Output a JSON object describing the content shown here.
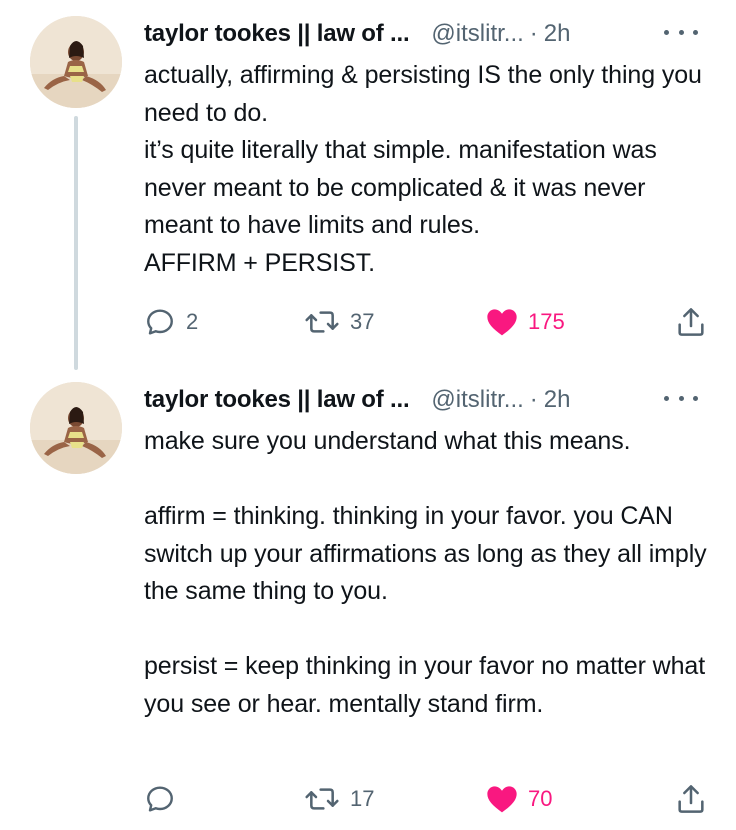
{
  "tweets": [
    {
      "author_name": "taylor tookes || law of ...",
      "handle": "@itslitr...",
      "separator": "·",
      "time": "2h",
      "text": "actually, affirming & persisting IS the only thing you need to do.\nit’s quite literally that simple. manifestation was never meant to be complicated & it was never meant to have limits and rules.\nAFFIRM + PERSIST.",
      "replies": "2",
      "retweets": "37",
      "likes": "175",
      "liked": true
    },
    {
      "author_name": "taylor tookes || law of ...",
      "handle": "@itslitr...",
      "separator": "·",
      "time": "2h",
      "text": "make sure you understand what this means.\n\naffirm = thinking. thinking in your favor. you CAN switch up your affirmations as long as they all imply the same thing to you.\n\npersist = keep thinking in your favor no matter what you see or hear. mentally stand firm.",
      "replies": "",
      "retweets": "17",
      "likes": "70",
      "liked": true
    }
  ],
  "icons": {
    "reply": "reply-icon",
    "retweet": "retweet-icon",
    "like": "heart-icon",
    "share": "share-icon",
    "more": "more-icon"
  },
  "colors": {
    "like_active": "#f91880",
    "secondary_text": "#536471",
    "thread_line": "#cfd9de"
  }
}
